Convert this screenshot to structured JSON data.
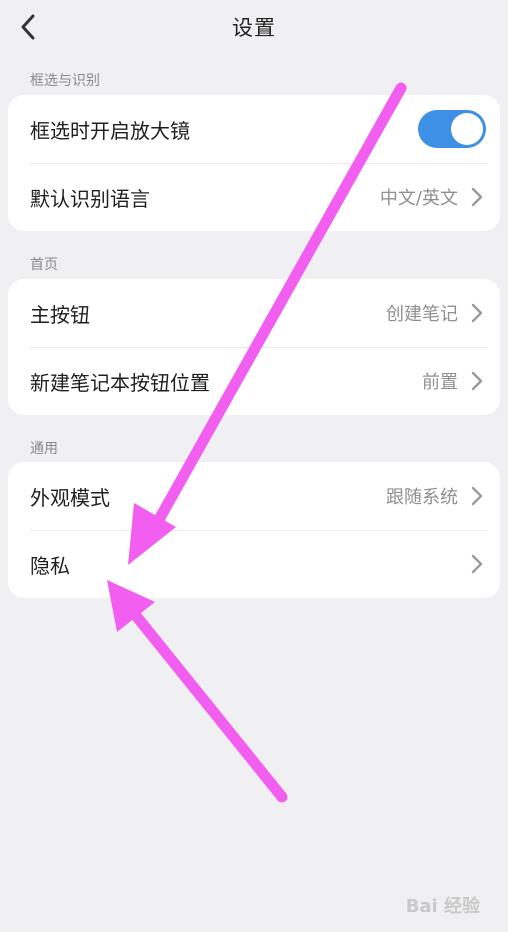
{
  "header": {
    "title": "设置"
  },
  "sections": [
    {
      "label": "框选与识别",
      "rows": [
        {
          "label": "框选时开启放大镜",
          "toggle_on": true
        },
        {
          "label": "默认识别语言",
          "value": "中文/英文"
        }
      ]
    },
    {
      "label": "首页",
      "rows": [
        {
          "label": "主按钮",
          "value": "创建笔记"
        },
        {
          "label": "新建笔记本按钮位置",
          "value": "前置"
        }
      ]
    },
    {
      "label": "通用",
      "rows": [
        {
          "label": "外观模式",
          "value": "跟随系统"
        },
        {
          "label": "隐私",
          "value": ""
        }
      ]
    }
  ],
  "colors": {
    "toggle_accent": "#3e8fe6",
    "annotation_arrow": "#f25ff0"
  },
  "watermark": "Bai 经验"
}
